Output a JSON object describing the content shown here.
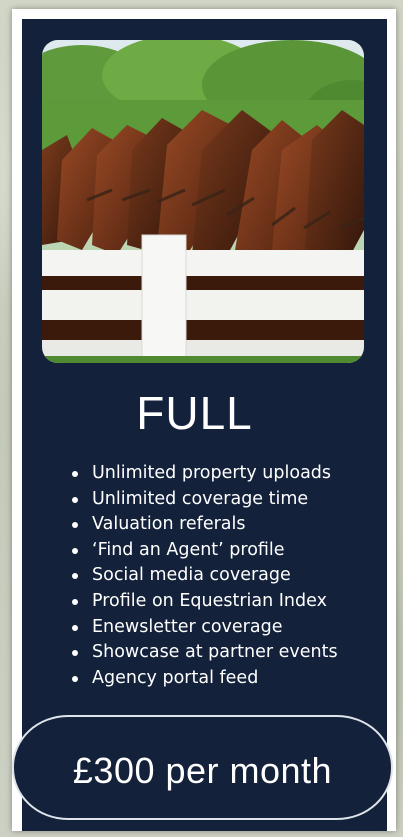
{
  "plan": {
    "title": "FULL",
    "image_alt": "Horses looking over a white fence",
    "features": [
      "Unlimited property uploads",
      "Unlimited coverage time",
      "Valuation referals",
      "‘Find an Agent’ profile",
      "Social media coverage",
      "Profile on Equestrian Index",
      "Enewsletter coverage",
      "Showcase at partner events",
      "Agency portal feed"
    ],
    "price": "£300 per month"
  },
  "colors": {
    "panel": "#13213a",
    "text": "#ffffff",
    "card": "#ffffff",
    "pill_border": "#dfe4ea"
  }
}
